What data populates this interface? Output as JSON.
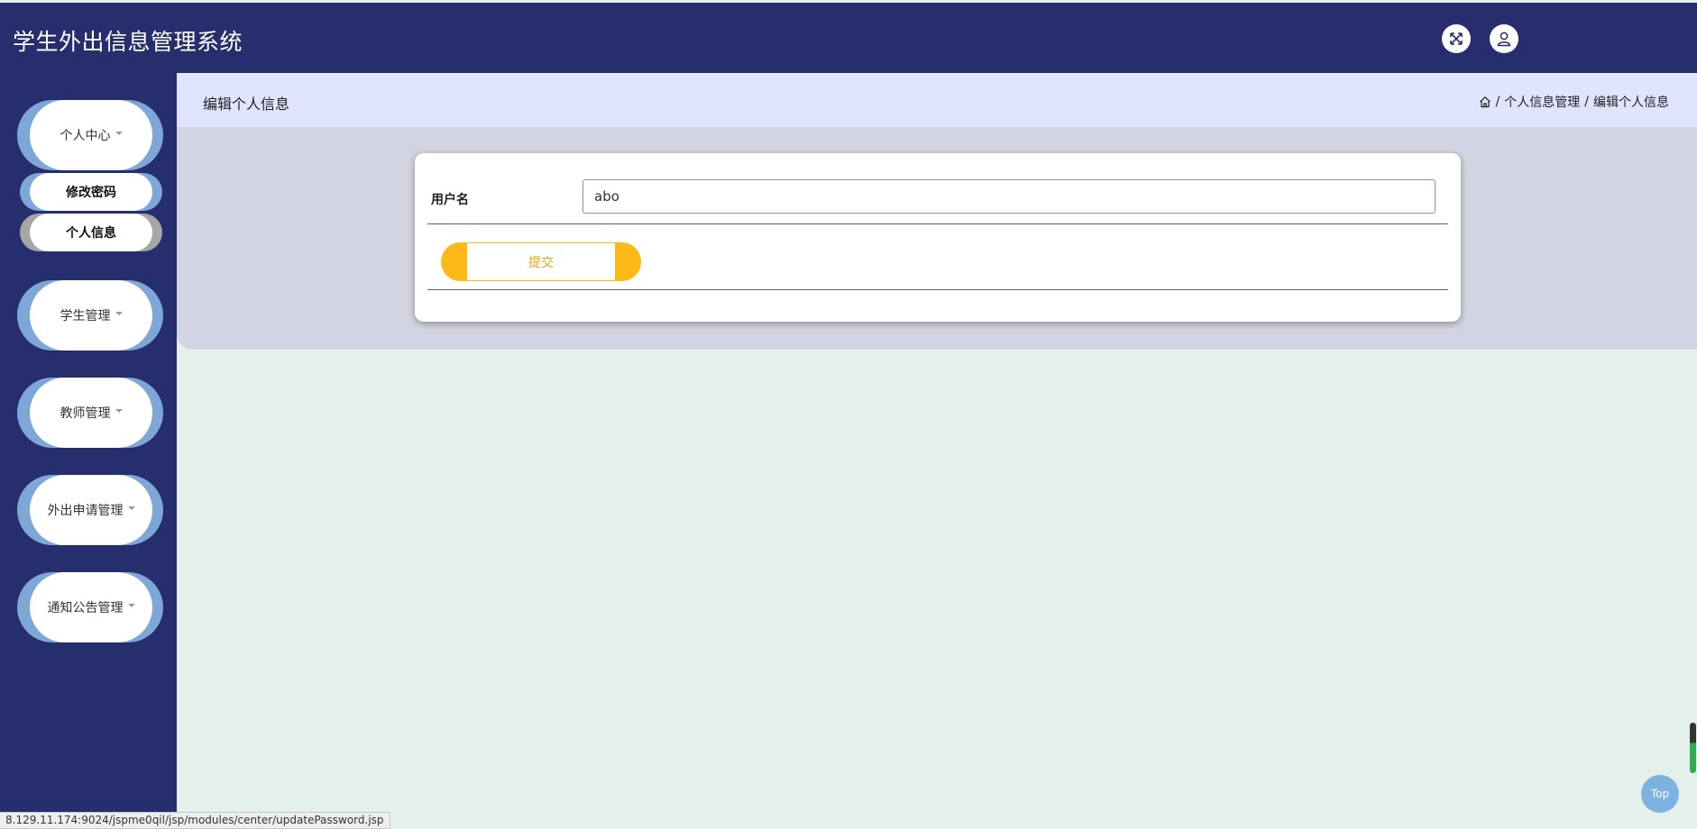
{
  "header": {
    "app_title": "学生外出信息管理系统",
    "fullscreen_icon": "expand-arrows",
    "user_icon": "user-outline"
  },
  "sidebar": {
    "items": [
      {
        "label": "个人中心",
        "expanded": true,
        "children": [
          {
            "label": "修改密码"
          },
          {
            "label": "个人信息"
          }
        ]
      },
      {
        "label": "学生管理"
      },
      {
        "label": "教师管理"
      },
      {
        "label": "外出申请管理"
      },
      {
        "label": "通知公告管理"
      }
    ]
  },
  "main": {
    "page_title": "编辑个人信息",
    "breadcrumb": {
      "home_icon": "home",
      "items": [
        "个人信息管理",
        "编辑个人信息"
      ],
      "separator": "/"
    },
    "form": {
      "username_label": "用户名",
      "username_value": "abo",
      "submit_label": "提交"
    }
  },
  "back_to_top": "Top",
  "status_bar_url": "8.129.11.174:9024/jspme0qil/jsp/modules/center/updatePassword.jsp",
  "colors": {
    "header_bg": "#262e6d",
    "sidebar_bg": "#262e6d",
    "accent_yellow": "#fdb918",
    "pill_blue": "#7ea6d6"
  }
}
